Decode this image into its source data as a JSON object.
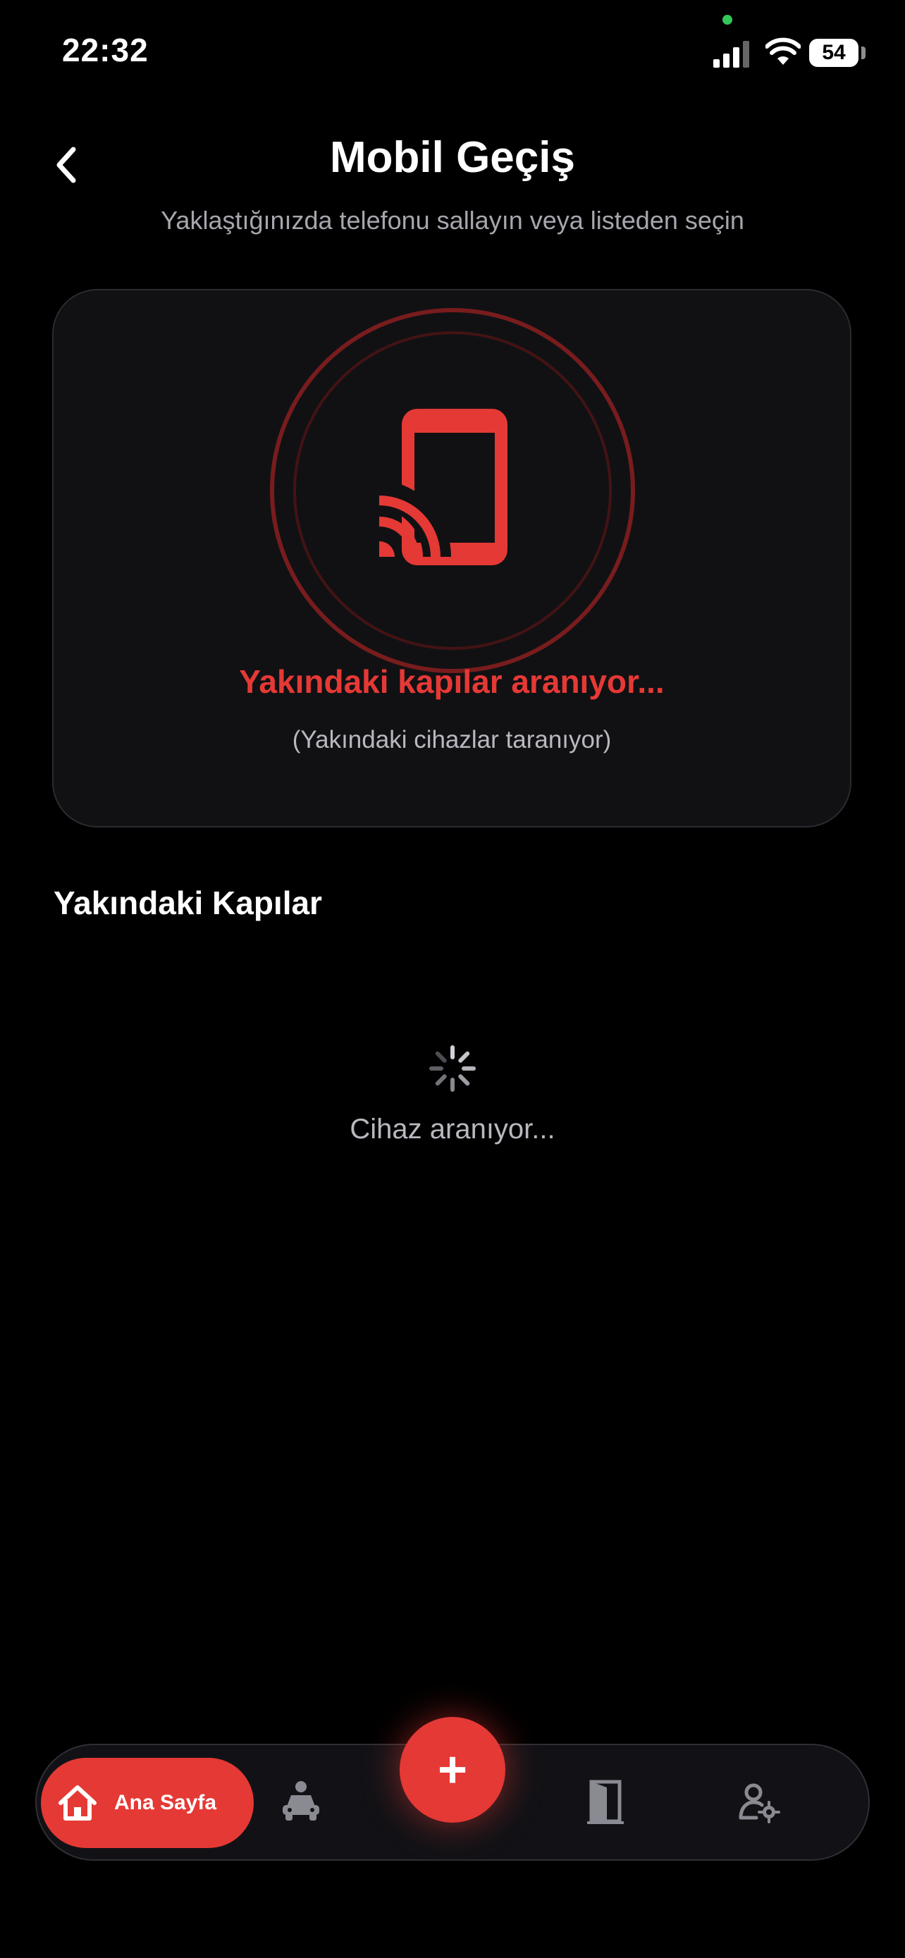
{
  "status_bar": {
    "time": "22:32",
    "battery": "54"
  },
  "header": {
    "title": "Mobil Geçiş",
    "subtitle": "Yaklaştığınızda telefonu sallayın veya listeden seçin"
  },
  "scan": {
    "status": "Yakındaki kapılar aranıyor...",
    "hint": "(Yakındaki cihazlar taranıyor)"
  },
  "nearby": {
    "title": "Yakındaki Kapılar",
    "loading": "Cihaz aranıyor..."
  },
  "bottom_nav": {
    "home_label": "Ana Sayfa",
    "fab_symbol": "+",
    "items": [
      "home-icon",
      "vehicle-icon",
      "add-icon",
      "door-icon",
      "user-settings-icon"
    ]
  },
  "colors": {
    "accent": "#e53935",
    "background": "#000000",
    "card": "#111114",
    "muted_text": "#b8b8bf"
  }
}
